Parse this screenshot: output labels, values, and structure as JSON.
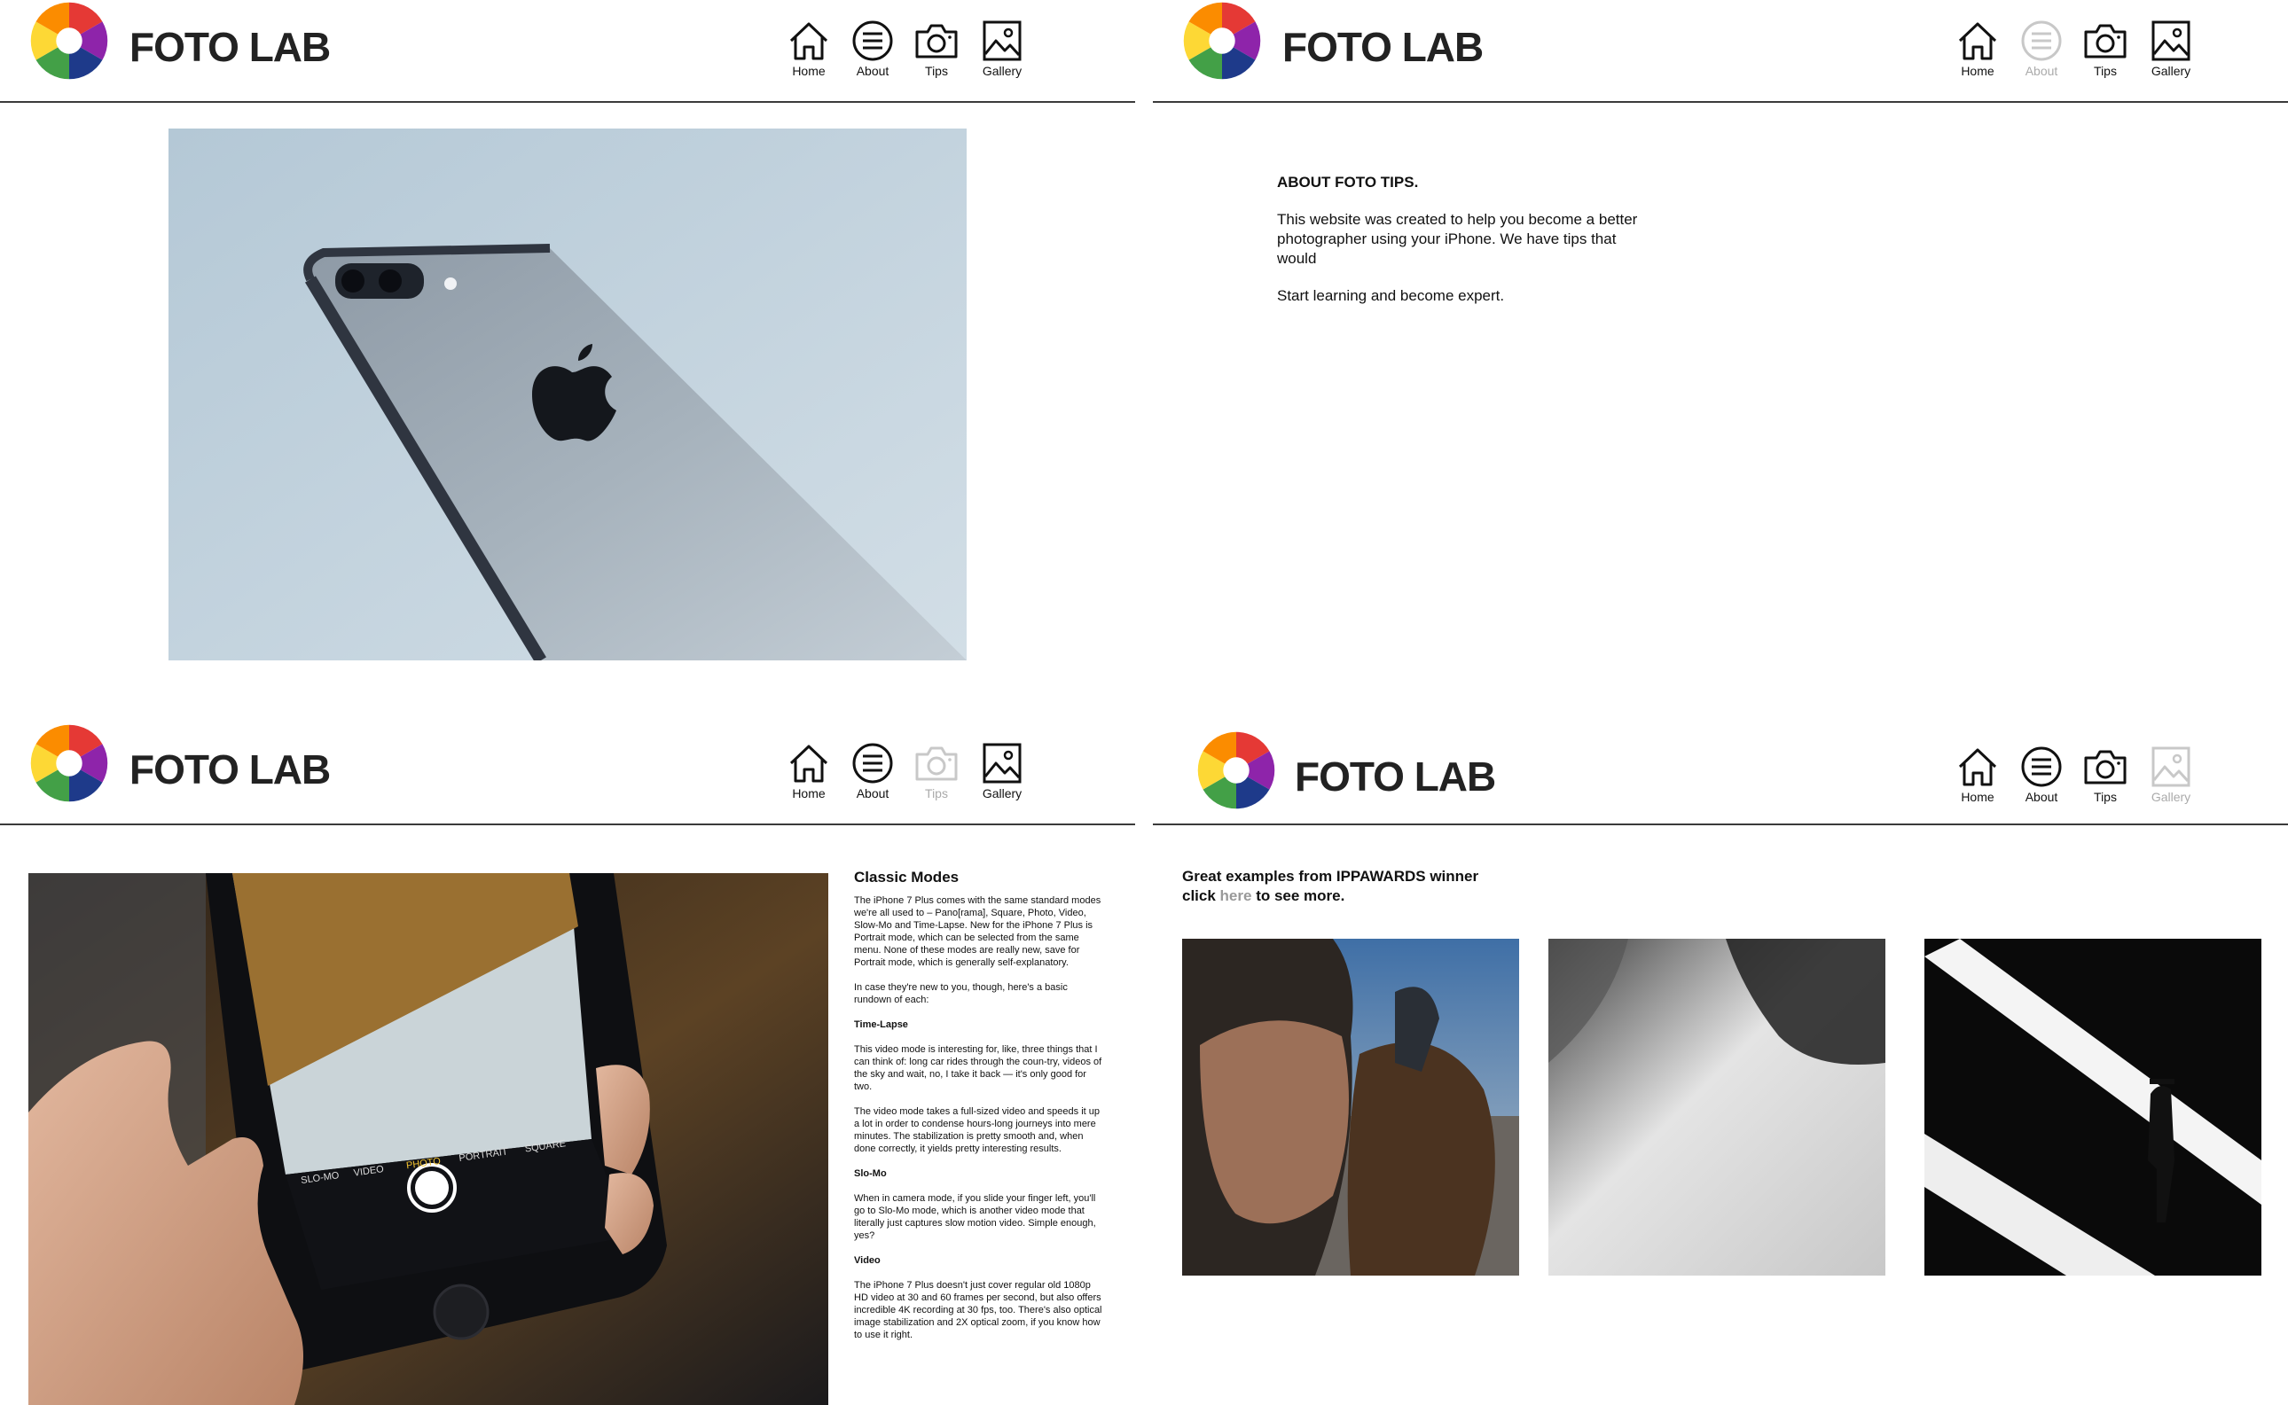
{
  "brand": {
    "name": "FOTO LAB"
  },
  "nav": {
    "home": "Home",
    "about": "About",
    "tips": "Tips",
    "gallery": "Gallery"
  },
  "about": {
    "title": "ABOUT FOTO TIPS.",
    "paragraph1": "This website was created to help you become a better photographer using your iPhone. We have tips that would",
    "paragraph2": "Start learning and become expert."
  },
  "tips": {
    "title": "Classic Modes",
    "intro": "The iPhone 7 Plus comes with the same standard modes we're all used to – Pano[rama], Square, Photo, Video, Slow-Mo and Time-Lapse. New for the iPhone 7 Plus is Portrait mode, which can be selected from the same menu. None of these modes are really new, save for Portrait mode, which is generally self-explanatory.",
    "intro2": "In case they're new to you, though, here's a basic rundown of each:",
    "sections": [
      {
        "heading": "Time-Lapse",
        "body": "This video mode is interesting for, like, three things that I can think of: long car rides through the coun-try, videos of the sky and wait, no, I take it back — it's only good for two."
      },
      {
        "heading": "",
        "body": "The video mode takes a full-sized video and speeds it up a lot in order to condense hours-long journeys into mere minutes. The stabilization is pretty smooth and, when done correctly, it yields pretty interesting results."
      },
      {
        "heading": "Slo-Mo",
        "body": "When in camera mode, if you slide your finger left, you'll go to Slo-Mo mode, which is another video mode that literally just captures slow motion video. Simple enough, yes?"
      },
      {
        "heading": "Video",
        "body": "The iPhone 7 Plus doesn't just cover regular old 1080p HD video at 30 and 60 frames per second, but also offers incredible 4K recording at 30 fps, too. There's also optical image stabilization and 2X optical zoom, if you know how to use it right."
      }
    ],
    "camera_modes": [
      "SLO-MO",
      "VIDEO",
      "PHOTO",
      "PORTRAIT",
      "SQUARE"
    ]
  },
  "gallery": {
    "line1": "Great examples from IPPAWARDS winner",
    "line2_pre": "click ",
    "line2_link": "here",
    "line2_post": " to see more."
  },
  "colors": {
    "logo_segments": [
      "#e53935",
      "#8e24aa",
      "#1e3a8a",
      "#43a047",
      "#fdd835",
      "#fb8c00"
    ],
    "active_nav": "#aaaaaa"
  }
}
